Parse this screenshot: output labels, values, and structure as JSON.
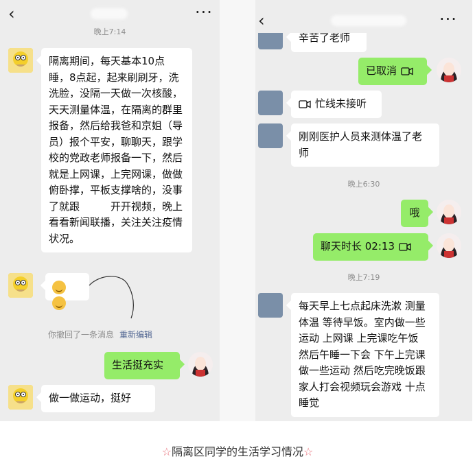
{
  "left_chat": {
    "top_time": "晚上7:14",
    "msg1": "隔离期间，每天基本10点睡，8点起，起来刷刷牙，洗洗脸，没隔一天做一次核酸，天天测量体温，在隔离的群里报备，然后给我爸和京姐（导员）报个平安，聊聊天，跟学校的党政老师报备一下，然后就是上网课，上完网课，做做俯卧撑，平板支撑啥的，没事了就跟　　　开开视频，晚上看看新闻联播，关注关注疫情状况。",
    "recall_notice": "你撤回了一条消息",
    "reedit_link": "重新编辑",
    "my_reply": "生活挺充实",
    "msg_last": "做一做运动，挺好"
  },
  "right_chat": {
    "top_partial": "辛苦了老师",
    "cancelled": "已取消",
    "missed_call": "忙线未接听",
    "medic_msg": "刚刚医护人员来测体温了老师",
    "time1": "晚上6:30",
    "oh": "哦",
    "call_duration": "聊天时长 02:13",
    "time2": "晚上7:19",
    "daily_msg": "每天早上七点起床洗漱 测量体温 等待早饭。室内做一些运动 上网课 上完课吃午饭 然后午睡一下会 下午上完课做一些运动 然后吃完晚饭跟家人打会视频玩会游戏 十点睡觉"
  },
  "caption": {
    "star": "☆",
    "text": "隔离区同学的生活学习情况"
  },
  "icons": [
    "back-arrow-icon",
    "more-dots-icon",
    "video-call-icon",
    "emoji-icon"
  ]
}
